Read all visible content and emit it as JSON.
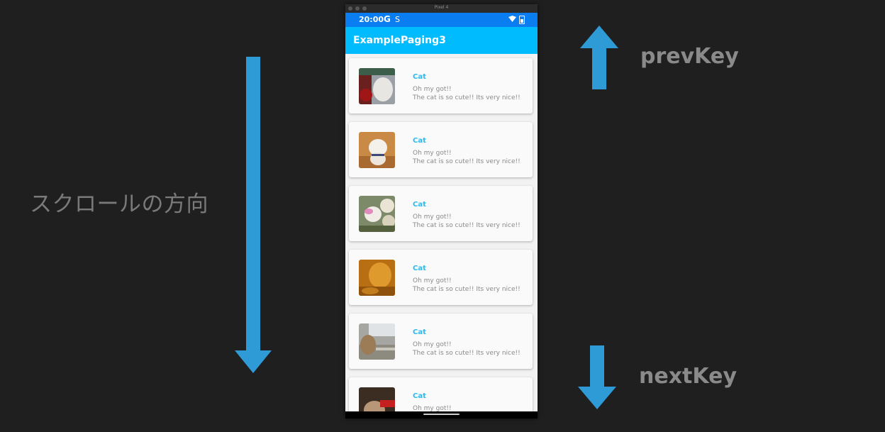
{
  "annotations": {
    "scroll_direction": "スクロールの方向",
    "prev_key": "prevKey",
    "next_key": "nextKey",
    "arrow_color": "#2e9bd6"
  },
  "emulator": {
    "title": "Pixel 4"
  },
  "status_bar": {
    "time": "20:00",
    "google_icon": "G",
    "sync_icon": "S",
    "color": "#0a7df0"
  },
  "app_bar": {
    "title": "ExamplePaging3",
    "color": "#00bcff"
  },
  "cards": [
    {
      "title": "Cat",
      "line1": "Oh my got!!",
      "line2": "The cat is so cute!! Its very nice!!",
      "image": "cat-photo-1"
    },
    {
      "title": "Cat",
      "line1": "Oh my got!!",
      "line2": "The cat is so cute!! Its very nice!!",
      "image": "cat-photo-2"
    },
    {
      "title": "Cat",
      "line1": "Oh my got!!",
      "line2": "The cat is so cute!! Its very nice!!",
      "image": "cat-photo-3"
    },
    {
      "title": "Cat",
      "line1": "Oh my got!!",
      "line2": "The cat is so cute!! Its very nice!!",
      "image": "cat-photo-4"
    },
    {
      "title": "Cat",
      "line1": "Oh my got!!",
      "line2": "The cat is so cute!! Its very nice!!",
      "image": "cat-photo-5"
    },
    {
      "title": "Cat",
      "line1": "Oh my got!!",
      "line2": "",
      "image": "cat-photo-6"
    }
  ]
}
